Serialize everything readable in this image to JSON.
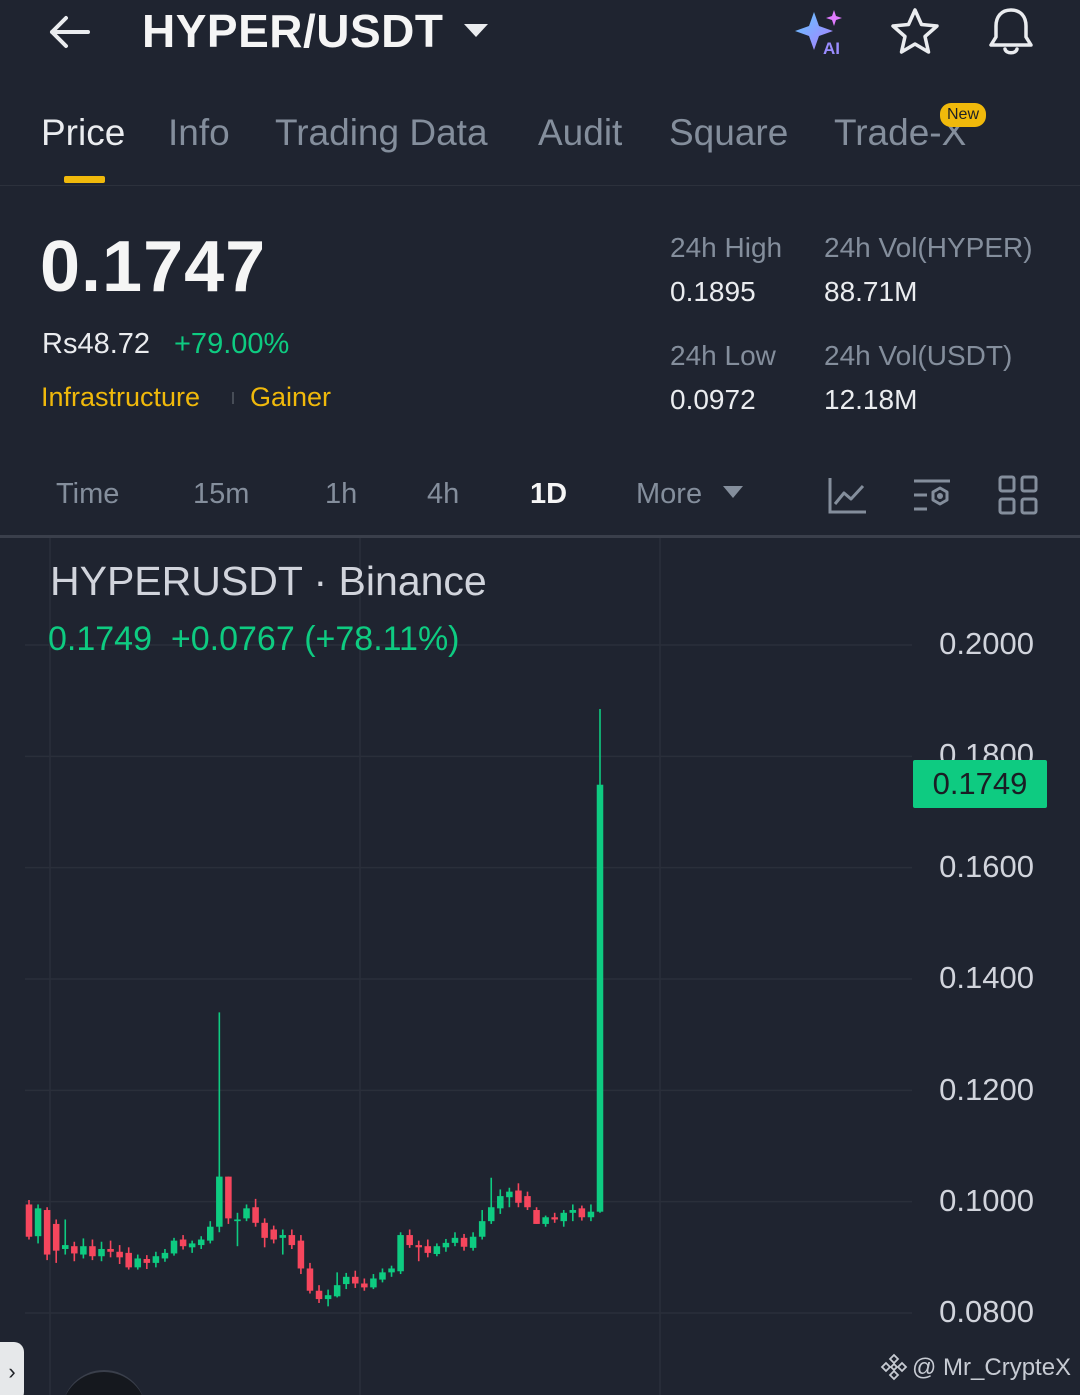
{
  "header": {
    "pair": "HYPER/USDT",
    "icons": [
      "back-arrow-icon",
      "chevron-down-icon",
      "ai-sparkle-icon",
      "star-icon",
      "bell-icon"
    ]
  },
  "tabs": [
    {
      "label": "Price",
      "active": true
    },
    {
      "label": "Info"
    },
    {
      "label": "Trading Data"
    },
    {
      "label": "Audit"
    },
    {
      "label": "Square"
    },
    {
      "label": "Trade-X",
      "badge": "New"
    }
  ],
  "summary": {
    "last_price": "0.1747",
    "fiat_price": "Rs48.72",
    "change_pct": "+79.00%",
    "tags": [
      "Infrastructure",
      "Gainer"
    ]
  },
  "stats": {
    "high_label": "24h High",
    "high_value": "0.1895",
    "low_label": "24h Low",
    "low_value": "0.0972",
    "vol_base_label": "24h Vol(HYPER)",
    "vol_base_value": "88.71M",
    "vol_quote_label": "24h Vol(USDT)",
    "vol_quote_value": "12.18M"
  },
  "intervals": [
    {
      "label": "Time"
    },
    {
      "label": "15m"
    },
    {
      "label": "1h"
    },
    {
      "label": "4h"
    },
    {
      "label": "1D",
      "active": true
    },
    {
      "label": "More"
    }
  ],
  "chart": {
    "symbol": "HYPERUSDT · Binance",
    "quote_price": "0.1749",
    "quote_change": "+0.0767 (+78.11%)",
    "last_price_tag": "0.1749",
    "y_ticks": [
      "0.2000",
      "0.1800",
      "0.1600",
      "0.1400",
      "0.1200",
      "0.1000",
      "0.0800"
    ],
    "watermark": "@ Mr_CryptеX",
    "side_handle": "›"
  },
  "colors": {
    "background": "#1f2430",
    "up": "#0ecb81",
    "down": "#f6465d",
    "accent": "#f0b90b",
    "muted": "#848e9c"
  },
  "chart_data": {
    "type": "candlestick",
    "y_axis": {
      "min": 0.08,
      "max": 0.2,
      "step": 0.02,
      "position": "right"
    },
    "grid": true,
    "candles": [
      {
        "o": 0.0995,
        "h": 0.1003,
        "l": 0.0932,
        "c": 0.0937
      },
      {
        "o": 0.0938,
        "h": 0.0995,
        "l": 0.0925,
        "c": 0.0988
      },
      {
        "o": 0.0985,
        "h": 0.099,
        "l": 0.0895,
        "c": 0.0905
      },
      {
        "o": 0.096,
        "h": 0.0968,
        "l": 0.089,
        "c": 0.0912
      },
      {
        "o": 0.0915,
        "h": 0.0968,
        "l": 0.0905,
        "c": 0.0922
      },
      {
        "o": 0.092,
        "h": 0.0928,
        "l": 0.0893,
        "c": 0.0907
      },
      {
        "o": 0.0905,
        "h": 0.0934,
        "l": 0.0898,
        "c": 0.092
      },
      {
        "o": 0.092,
        "h": 0.0932,
        "l": 0.0895,
        "c": 0.0902
      },
      {
        "o": 0.0902,
        "h": 0.0928,
        "l": 0.0893,
        "c": 0.0915
      },
      {
        "o": 0.0915,
        "h": 0.093,
        "l": 0.09,
        "c": 0.091
      },
      {
        "o": 0.091,
        "h": 0.0922,
        "l": 0.0888,
        "c": 0.09
      },
      {
        "o": 0.0908,
        "h": 0.0918,
        "l": 0.0878,
        "c": 0.0882
      },
      {
        "o": 0.0882,
        "h": 0.0905,
        "l": 0.0878,
        "c": 0.0898
      },
      {
        "o": 0.0897,
        "h": 0.0904,
        "l": 0.0879,
        "c": 0.089
      },
      {
        "o": 0.089,
        "h": 0.091,
        "l": 0.0882,
        "c": 0.0902
      },
      {
        "o": 0.0898,
        "h": 0.0915,
        "l": 0.0892,
        "c": 0.0908
      },
      {
        "o": 0.0907,
        "h": 0.0935,
        "l": 0.0903,
        "c": 0.093
      },
      {
        "o": 0.0932,
        "h": 0.094,
        "l": 0.0914,
        "c": 0.092
      },
      {
        "o": 0.0918,
        "h": 0.093,
        "l": 0.0908,
        "c": 0.0925
      },
      {
        "o": 0.0922,
        "h": 0.0938,
        "l": 0.0915,
        "c": 0.0932
      },
      {
        "o": 0.093,
        "h": 0.0965,
        "l": 0.0925,
        "c": 0.0955
      },
      {
        "o": 0.0955,
        "h": 0.134,
        "l": 0.0945,
        "c": 0.1045
      },
      {
        "o": 0.1045,
        "h": 0.1045,
        "l": 0.096,
        "c": 0.097
      },
      {
        "o": 0.0965,
        "h": 0.098,
        "l": 0.092,
        "c": 0.0968
      },
      {
        "o": 0.097,
        "h": 0.0995,
        "l": 0.0965,
        "c": 0.0988
      },
      {
        "o": 0.099,
        "h": 0.1005,
        "l": 0.0955,
        "c": 0.0962
      },
      {
        "o": 0.0962,
        "h": 0.097,
        "l": 0.0918,
        "c": 0.0935
      },
      {
        "o": 0.095,
        "h": 0.0957,
        "l": 0.0925,
        "c": 0.0932
      },
      {
        "o": 0.0935,
        "h": 0.095,
        "l": 0.0905,
        "c": 0.094
      },
      {
        "o": 0.094,
        "h": 0.095,
        "l": 0.0915,
        "c": 0.0922
      },
      {
        "o": 0.093,
        "h": 0.094,
        "l": 0.087,
        "c": 0.088
      },
      {
        "o": 0.088,
        "h": 0.089,
        "l": 0.0835,
        "c": 0.084
      },
      {
        "o": 0.084,
        "h": 0.085,
        "l": 0.0818,
        "c": 0.0825
      },
      {
        "o": 0.0825,
        "h": 0.0842,
        "l": 0.0812,
        "c": 0.0832
      },
      {
        "o": 0.083,
        "h": 0.0873,
        "l": 0.0828,
        "c": 0.085
      },
      {
        "o": 0.0852,
        "h": 0.0872,
        "l": 0.0843,
        "c": 0.0865
      },
      {
        "o": 0.0865,
        "h": 0.0876,
        "l": 0.0845,
        "c": 0.0853
      },
      {
        "o": 0.0853,
        "h": 0.0862,
        "l": 0.084,
        "c": 0.0846
      },
      {
        "o": 0.0846,
        "h": 0.087,
        "l": 0.0843,
        "c": 0.0862
      },
      {
        "o": 0.086,
        "h": 0.088,
        "l": 0.0855,
        "c": 0.0873
      },
      {
        "o": 0.0873,
        "h": 0.0885,
        "l": 0.0865,
        "c": 0.088
      },
      {
        "o": 0.0875,
        "h": 0.0945,
        "l": 0.087,
        "c": 0.094
      },
      {
        "o": 0.094,
        "h": 0.095,
        "l": 0.0917,
        "c": 0.0922
      },
      {
        "o": 0.0922,
        "h": 0.093,
        "l": 0.0893,
        "c": 0.0918
      },
      {
        "o": 0.092,
        "h": 0.0932,
        "l": 0.09,
        "c": 0.0908
      },
      {
        "o": 0.0906,
        "h": 0.0925,
        "l": 0.0902,
        "c": 0.092
      },
      {
        "o": 0.0918,
        "h": 0.0933,
        "l": 0.091,
        "c": 0.0926
      },
      {
        "o": 0.0926,
        "h": 0.0945,
        "l": 0.092,
        "c": 0.0935
      },
      {
        "o": 0.0935,
        "h": 0.0942,
        "l": 0.0912,
        "c": 0.0919
      },
      {
        "o": 0.0917,
        "h": 0.0945,
        "l": 0.0912,
        "c": 0.0937
      },
      {
        "o": 0.0937,
        "h": 0.0985,
        "l": 0.0932,
        "c": 0.0965
      },
      {
        "o": 0.0965,
        "h": 0.1043,
        "l": 0.096,
        "c": 0.099
      },
      {
        "o": 0.0988,
        "h": 0.1022,
        "l": 0.0978,
        "c": 0.101
      },
      {
        "o": 0.1008,
        "h": 0.1025,
        "l": 0.099,
        "c": 0.1018
      },
      {
        "o": 0.102,
        "h": 0.1033,
        "l": 0.099,
        "c": 0.0998
      },
      {
        "o": 0.101,
        "h": 0.1018,
        "l": 0.0985,
        "c": 0.099
      },
      {
        "o": 0.0985,
        "h": 0.099,
        "l": 0.096,
        "c": 0.096
      },
      {
        "o": 0.096,
        "h": 0.0975,
        "l": 0.0955,
        "c": 0.0972
      },
      {
        "o": 0.0972,
        "h": 0.098,
        "l": 0.0962,
        "c": 0.0968
      },
      {
        "o": 0.0965,
        "h": 0.0985,
        "l": 0.0955,
        "c": 0.098
      },
      {
        "o": 0.098,
        "h": 0.0995,
        "l": 0.0965,
        "c": 0.0985
      },
      {
        "o": 0.0988,
        "h": 0.0993,
        "l": 0.0966,
        "c": 0.0972
      },
      {
        "o": 0.0972,
        "h": 0.0995,
        "l": 0.0965,
        "c": 0.0982
      },
      {
        "o": 0.0982,
        "h": 0.1885,
        "l": 0.098,
        "c": 0.1749
      }
    ]
  }
}
